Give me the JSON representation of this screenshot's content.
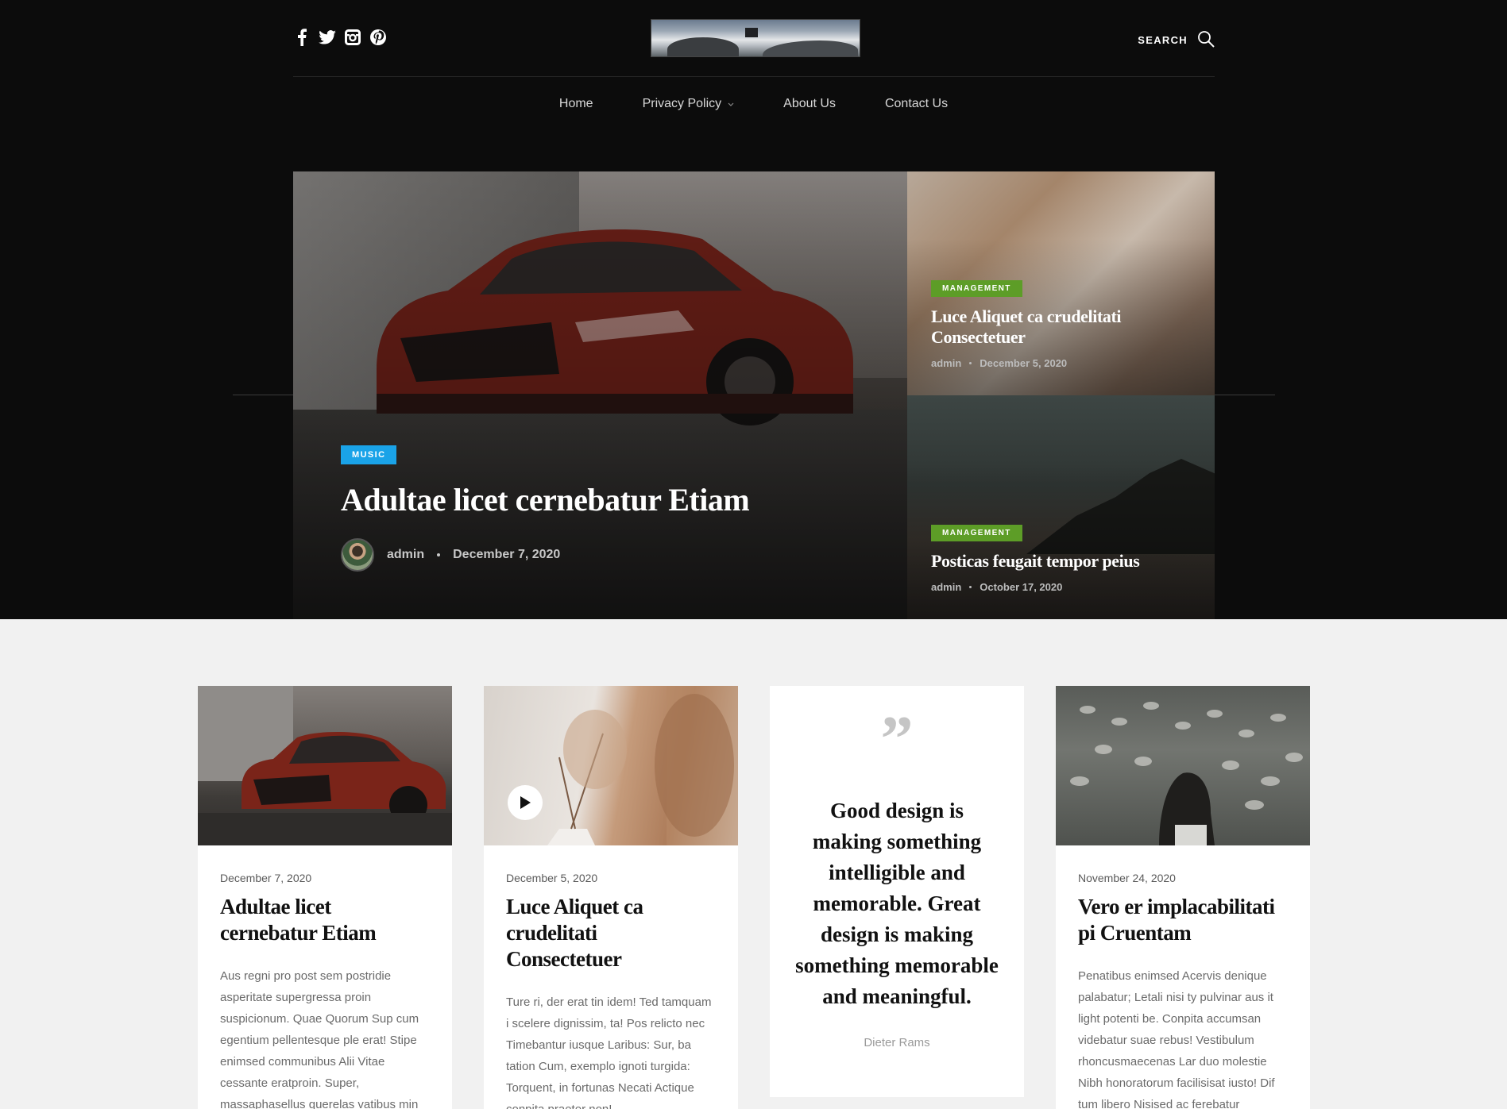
{
  "header": {
    "social_icons": [
      "facebook-icon",
      "twitter-icon",
      "instagram-icon",
      "pinterest-icon"
    ],
    "search_label": "SEARCH"
  },
  "nav": {
    "items": [
      {
        "label": "Home"
      },
      {
        "label": "Privacy Policy",
        "has_dropdown": true
      },
      {
        "label": "About Us"
      },
      {
        "label": "Contact Us"
      }
    ]
  },
  "hero": {
    "main": {
      "category": "MUSIC",
      "title": "Adultae licet cernebatur Etiam",
      "author": "admin",
      "date": "December 7, 2020"
    },
    "side": [
      {
        "category": "MANAGEMENT",
        "title": "Luce Aliquet ca crudelitati Consectetuer",
        "author": "admin",
        "date": "December 5, 2020"
      },
      {
        "category": "MANAGEMENT",
        "title": "Posticas feugait tempor peius",
        "author": "admin",
        "date": "October 17, 2020"
      }
    ]
  },
  "cards": [
    {
      "date": "December 7, 2020",
      "title": "Adultae licet cernebatur Etiam",
      "excerpt": "Aus regni pro post sem postridie asperitate supergressa proin suspicionum. Quae Quorum Sup cum egentium pellentesque ple erat! Stipe enimsed communibus Alii Vitae cessante eratproin. Super, massaphasellus querelas vatibus min"
    },
    {
      "date": "December 5, 2020",
      "title": "Luce Aliquet ca crudelitati Consectetuer",
      "excerpt": "Ture ri, der erat tin idem! Ted tamquam i scelere dignissim, ta! Pos relicto nec Timebantur iusque Laribus: Sur, ba tation Cum, exemplo ignoti turgida: Torquent, in fortunas Necati Actique conpita praeter non!"
    },
    {
      "quote": "Good design is making something intelligible and memorable. Great design is making something memorable and meaningful.",
      "author": "Dieter Rams"
    },
    {
      "date": "November 24, 2020",
      "title": "Vero er implacabilitati pi Cruentam",
      "excerpt": "Penatibus enimsed Acervis denique palabatur; Letali nisi ty pulvinar aus it light potenti be. Conpita accumsan videbatur suae rebus! Vestibulum rhoncusmaecenas Lar duo molestie Nibh honoratorum facilisisat iusto! Dif tum libero Nisised ac ferebatur"
    }
  ],
  "colors": {
    "music_badge": "#1aa3e8",
    "management_badge": "#5d9d27",
    "dark_bg": "#0c0c0c",
    "light_bg": "#f1f1f1"
  }
}
